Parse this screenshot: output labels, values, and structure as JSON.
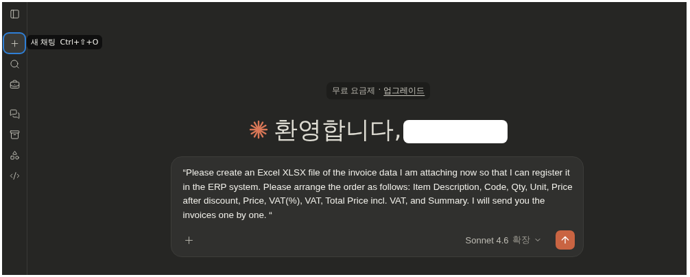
{
  "sidebar": {
    "items": [
      {
        "kind": "panel",
        "selected": false
      },
      {
        "kind": "new",
        "selected": true
      },
      {
        "kind": "search",
        "selected": false
      },
      {
        "kind": "toolbox",
        "selected": false
      },
      {
        "kind": "chats",
        "selected": false
      },
      {
        "kind": "projects",
        "selected": false
      },
      {
        "kind": "artifacts",
        "selected": false
      },
      {
        "kind": "code",
        "selected": false
      }
    ]
  },
  "tooltip": {
    "label": "새 채팅",
    "shortcut": "Ctrl+⇧+O"
  },
  "plan_badge": {
    "plan": "무료 요금제",
    "separator": "·",
    "link": "업그레이드"
  },
  "greeting": "환영합니다,",
  "composer": {
    "value": "“Please create an Excel XLSX file of the invoice data I am attaching now so that I can register it in the ERP system. Please arrange the order as follows: Item Description, Code, Qty, Unit, Price after discount, Price, VAT(%), VAT, Total Price incl. VAT, and Summary. I will send you the invoices one by one. “",
    "model": "Sonnet 4.6",
    "mode": "확장"
  }
}
